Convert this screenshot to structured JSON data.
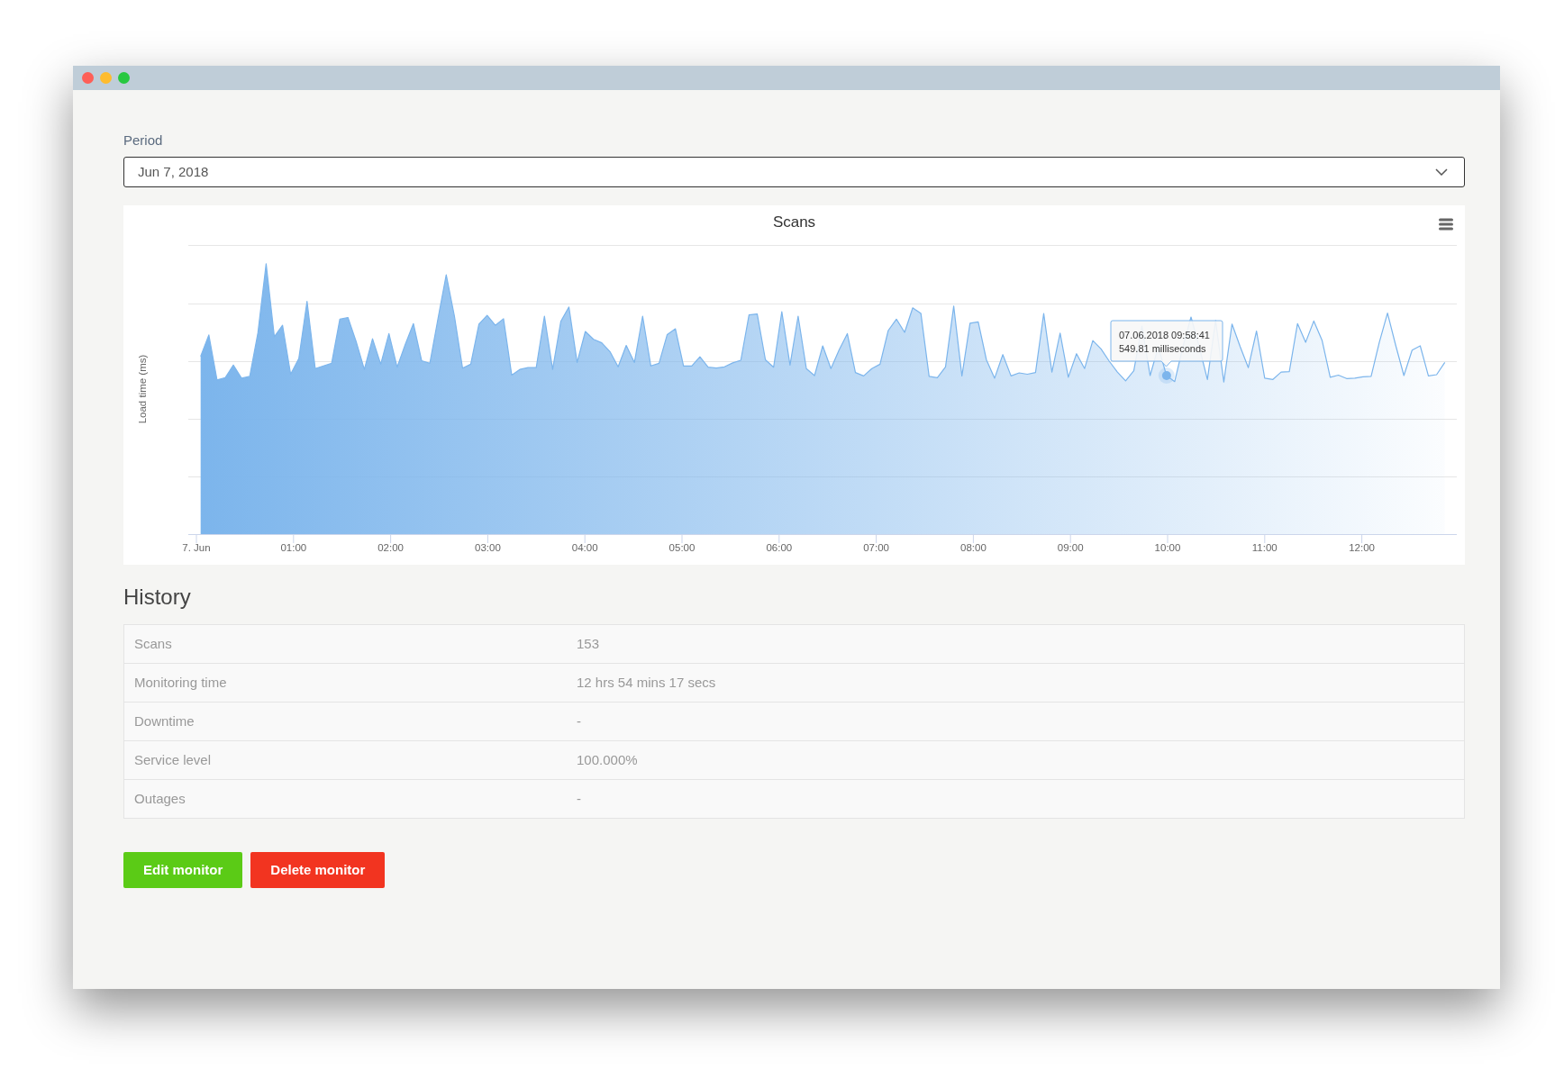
{
  "window_controls": [
    {
      "color": "#fe5f57"
    },
    {
      "color": "#febc2e"
    },
    {
      "color": "#28c840"
    }
  ],
  "period": {
    "label": "Period",
    "value": "Jun 7, 2018"
  },
  "chart": {
    "title": "Scans",
    "y_axis_title": "Load time (ms)",
    "x_axis_labels": [
      "7. Jun",
      "01:00",
      "02:00",
      "03:00",
      "04:00",
      "05:00",
      "06:00",
      "07:00",
      "08:00",
      "09:00",
      "10:00",
      "11:00",
      "12:00"
    ],
    "tooltip": {
      "time": "07.06.2018 09:58:41",
      "value": "549.81 milliseconds"
    }
  },
  "history": {
    "title": "History",
    "rows": [
      {
        "label": "Scans",
        "value": "153"
      },
      {
        "label": "Monitoring time",
        "value": "12 hrs 54 mins 17 secs"
      },
      {
        "label": "Downtime",
        "value": "-"
      },
      {
        "label": "Service level",
        "value": "100.000%"
      },
      {
        "label": "Outages",
        "value": "-"
      }
    ]
  },
  "buttons": [
    {
      "kind": "edit",
      "label": "Edit monitor"
    },
    {
      "kind": "delete",
      "label": "Delete monitor"
    }
  ]
}
